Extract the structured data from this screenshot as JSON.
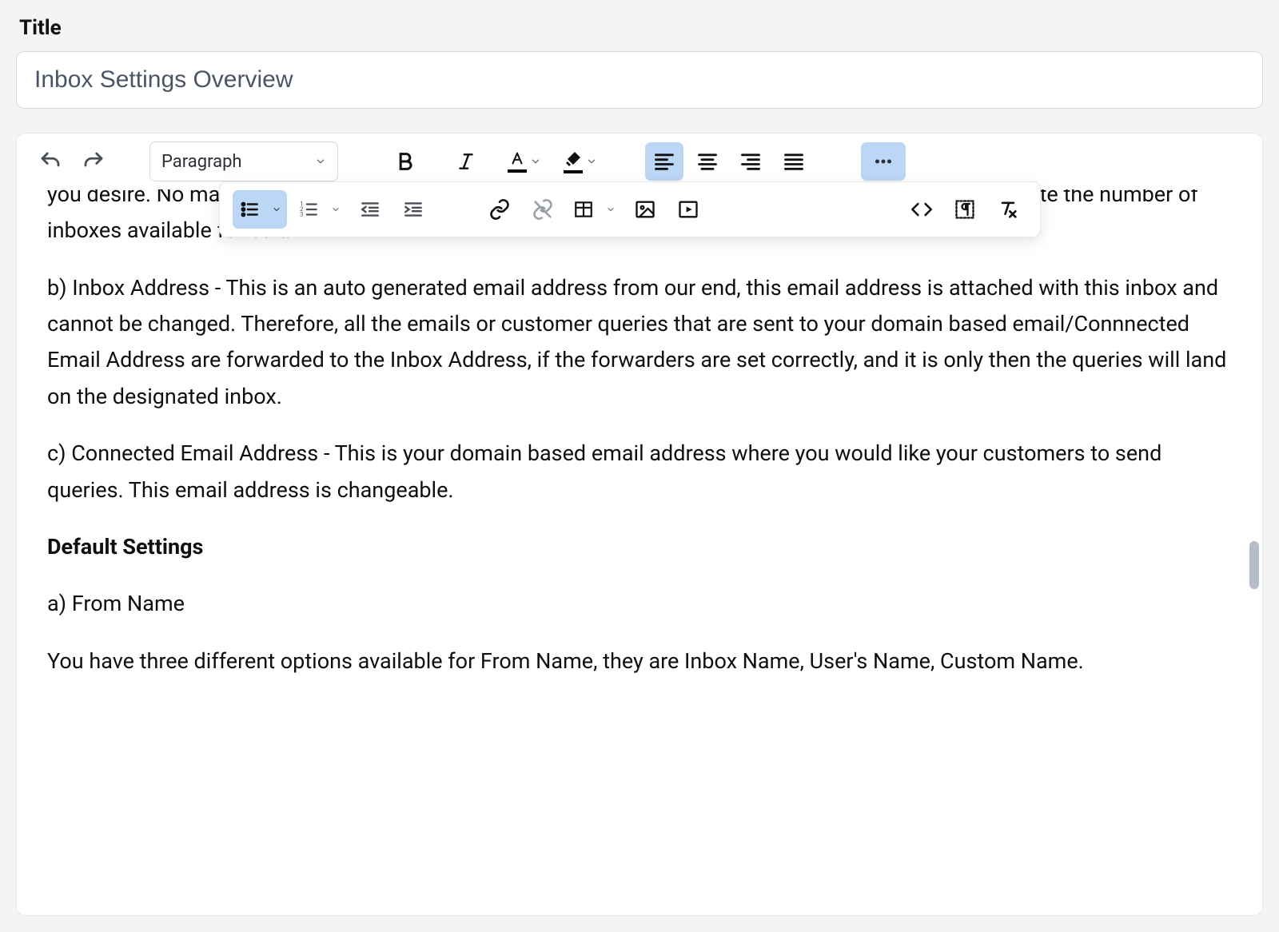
{
  "title_section": {
    "label": "Title",
    "value": "Inbox Settings Overview"
  },
  "toolbar": {
    "block_format": "Paragraph",
    "text_color": "#000000",
    "highlight_color": "#000000",
    "alignment_active": "left",
    "list_active": "bullet"
  },
  "content": {
    "para_a_partial": "you desire. No matter the From Name (See below) of senders name are set as inbox, it is just to segregate the number of inboxes available for edit.",
    "para_b": "b) Inbox Address - This is an auto generated email address from our end, this email address is attached with this inbox and cannot be changed. Therefore, all the emails or customer queries that are sent to your domain based email/Connnected Email Address are forwarded to the Inbox Address, if the forwarders are set correctly, and it is only then the queries will land on the designated inbox.",
    "para_c": "c) Connected Email Address - This is your domain based email address where you would like your customers to send queries. This email address is changeable.",
    "heading_default": "Default Settings",
    "para_from_name": "a) From Name",
    "para_from_options": "You have three different options available for From Name, they are Inbox Name, User's Name, Custom Name."
  }
}
